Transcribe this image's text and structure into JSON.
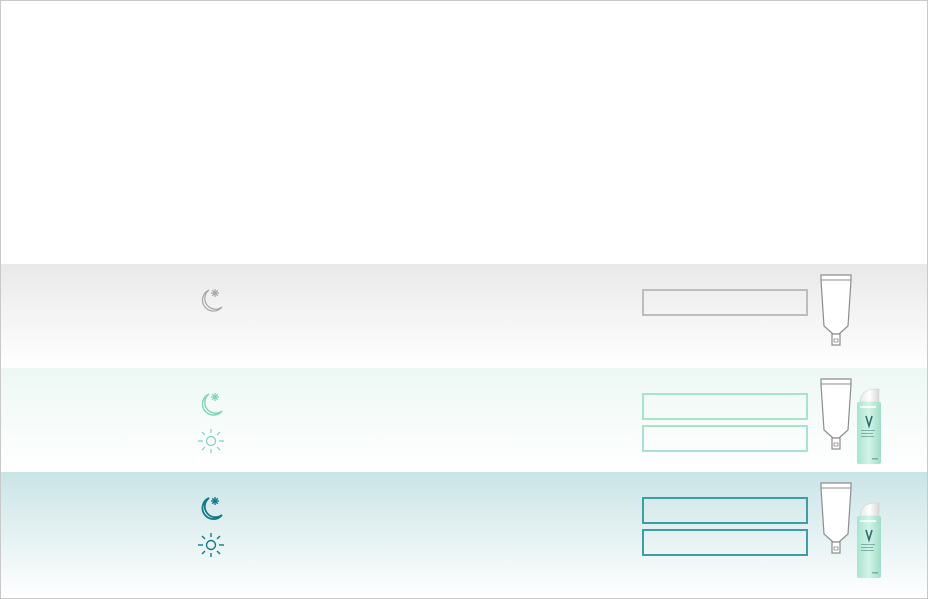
{
  "routine_rows": [
    {
      "id": "row-1",
      "steps": [
        {
          "time": "night",
          "icon": "moon-star-icon",
          "label": ""
        }
      ],
      "products": [
        "cream-tube-outline"
      ]
    },
    {
      "id": "row-2",
      "steps": [
        {
          "time": "night",
          "icon": "moon-star-icon",
          "label": ""
        },
        {
          "time": "day",
          "icon": "sun-icon",
          "label": ""
        }
      ],
      "products": [
        "cream-tube-outline",
        "normaderm-bottle"
      ]
    },
    {
      "id": "row-3",
      "steps": [
        {
          "time": "night",
          "icon": "moon-star-icon",
          "label": ""
        },
        {
          "time": "day",
          "icon": "sun-icon",
          "label": ""
        }
      ],
      "products": [
        "cream-tube-outline",
        "normaderm-bottle"
      ]
    }
  ],
  "colors": {
    "row1_accent": "#a6a6a6",
    "row2_accent": "#7fd4b4",
    "row3_accent": "#127a86",
    "bottle_mint": "#bfeedd",
    "tube_outline": "#8c8c8c"
  }
}
